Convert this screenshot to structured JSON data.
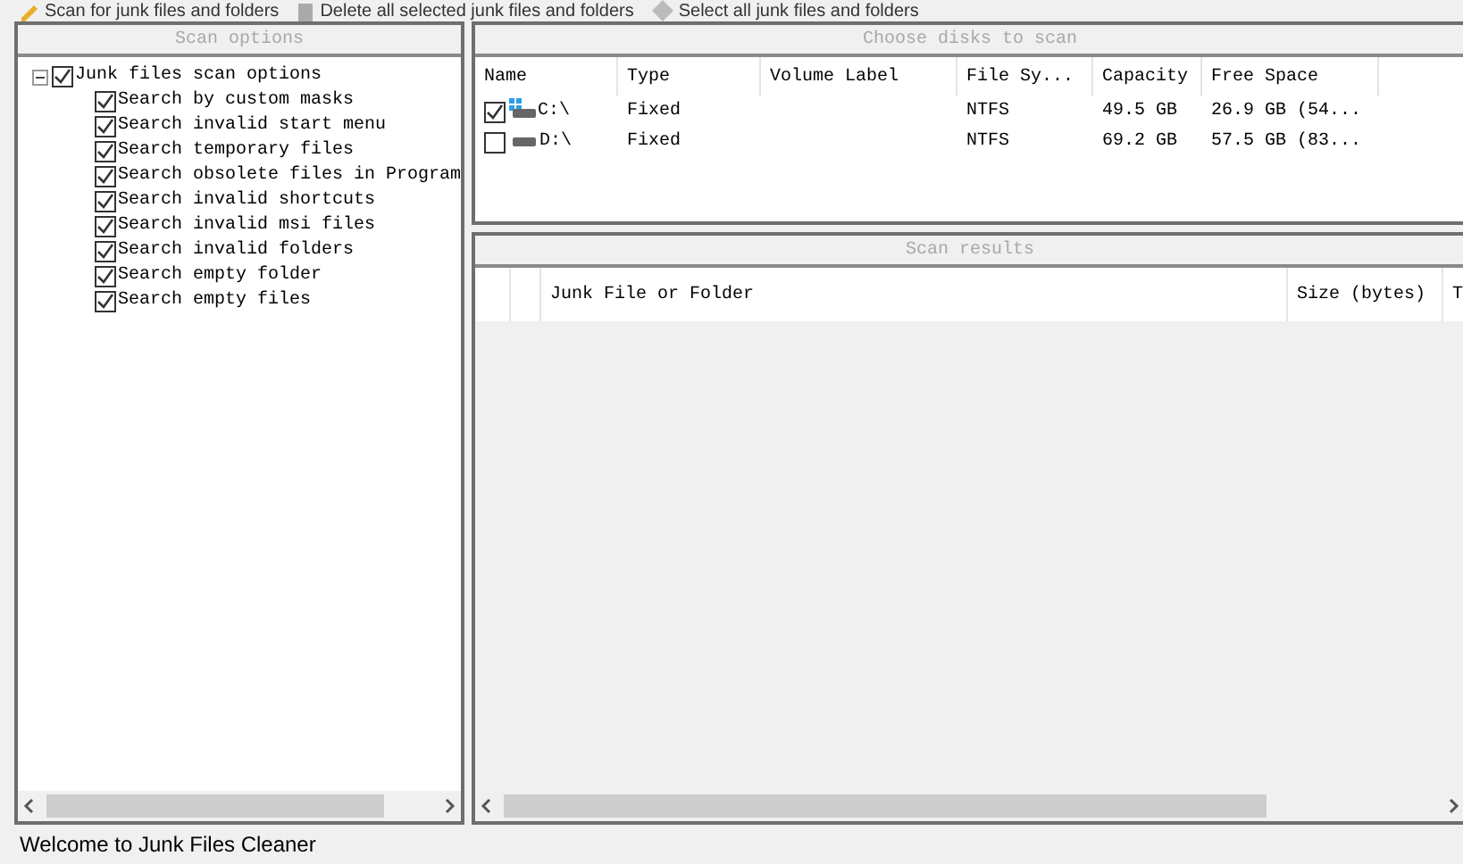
{
  "toolbar": [
    {
      "label": "Scan for junk files and folders",
      "kind": "scan"
    },
    {
      "label": "Delete all selected junk files and folders",
      "kind": "delete"
    },
    {
      "label": "Select all junk files and folders",
      "kind": "select"
    }
  ],
  "scan_options": {
    "title": "Scan options",
    "root": {
      "label": "Junk files scan options",
      "checked": true,
      "expanded": true,
      "children": [
        {
          "label": "Search by custom masks",
          "checked": true
        },
        {
          "label": "Search invalid start menu",
          "checked": true
        },
        {
          "label": "Search temporary files",
          "checked": true
        },
        {
          "label": "Search obsolete files in Program",
          "checked": true
        },
        {
          "label": "Search invalid shortcuts",
          "checked": true
        },
        {
          "label": "Search invalid msi files",
          "checked": true
        },
        {
          "label": "Search invalid folders",
          "checked": true
        },
        {
          "label": "Search empty folder",
          "checked": true
        },
        {
          "label": "Search empty files",
          "checked": true
        }
      ]
    }
  },
  "disks": {
    "title": "Choose disks to scan",
    "columns": [
      "Name",
      "Type",
      "Volume Label",
      "File Sy...",
      "Capacity",
      "Free Space"
    ],
    "rows": [
      {
        "checked": true,
        "system": true,
        "cells": [
          "C:\\",
          "Fixed",
          "",
          "NTFS",
          "49.5 GB",
          "26.9 GB (54..."
        ]
      },
      {
        "checked": false,
        "system": false,
        "cells": [
          "D:\\",
          "Fixed",
          "",
          "NTFS",
          "69.2 GB",
          "57.5 GB (83..."
        ]
      }
    ]
  },
  "results": {
    "title": "Scan results",
    "columns": [
      "",
      "",
      "Junk File or Folder",
      "Size (bytes)",
      "T"
    ]
  },
  "status_bar": "Welcome to Junk Files Cleaner"
}
